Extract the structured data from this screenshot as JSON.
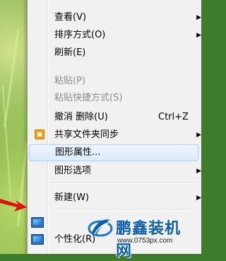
{
  "menu": {
    "items": [
      {
        "label": "查看(V)",
        "has_submenu": true,
        "disabled": false
      },
      {
        "label": "排序方式(O)",
        "has_submenu": true,
        "disabled": false
      },
      {
        "label": "刷新(E)",
        "has_submenu": false,
        "disabled": false
      },
      {
        "label": "粘贴(P)",
        "has_submenu": false,
        "disabled": true
      },
      {
        "label": "粘贴快捷方式(S)",
        "has_submenu": false,
        "disabled": true
      },
      {
        "label": "撤消 删除(U)",
        "shortcut": "Ctrl+Z",
        "has_submenu": false,
        "disabled": false
      },
      {
        "label": "共享文件夹同步",
        "icon": "shared-folder-sync-icon",
        "has_submenu": true,
        "disabled": false
      },
      {
        "label": "图形属性...",
        "has_submenu": false,
        "disabled": false,
        "highlighted": true
      },
      {
        "label": "图形选项",
        "has_submenu": true,
        "disabled": false
      },
      {
        "label": "新建(W)",
        "has_submenu": true,
        "disabled": false
      },
      {
        "label": "个性化(R)",
        "icon": "personalize-icon",
        "has_submenu": false,
        "disabled": false
      }
    ]
  },
  "watermark": {
    "title": "鹏鑫装机网",
    "url": "www.0753px.com"
  },
  "colors": {
    "menu_bg": "#f1f1f1",
    "highlight_border": "#aecff7",
    "disabled_text": "#8c8c8c",
    "watermark_blue": "#0b5fb0"
  }
}
